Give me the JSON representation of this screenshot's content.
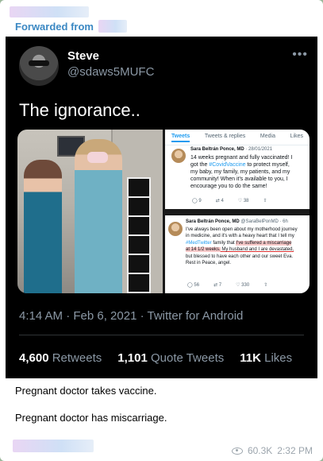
{
  "message": {
    "forwarded_label": "Forwarded from",
    "caption_lines": [
      "Pregnant doctor takes vaccine.",
      "Pregnant doctor has miscarriage."
    ],
    "views": "60.3K",
    "time": "2:32 PM"
  },
  "tweet": {
    "author_name": "Steve",
    "author_handle": "@sdaws5MUFC",
    "more": "•••",
    "text": "The ignorance..",
    "timestamp": "4:14 AM · Feb 6, 2021",
    "source": "Twitter for Android",
    "stats": [
      {
        "value": "4,600",
        "label": "Retweets"
      },
      {
        "value": "1,101",
        "label": "Quote Tweets"
      },
      {
        "value": "11K",
        "label": "Likes"
      }
    ]
  },
  "embedded_screenshot_top": {
    "tabs": [
      "Tweets",
      "Tweets & replies",
      "Media",
      "Likes"
    ],
    "author": "Sara Beltrán Ponce, MD",
    "date": "· 28/01/2021",
    "line1": "14 weeks pregnant and fully vaccinated! I",
    "line2_a": "got the ",
    "hashtag": "#CovidVaccine",
    "line2_b": " to protect myself,",
    "line3": "my baby, my family, my patients, and my",
    "line4": "community! When it's available to you, I",
    "line5": "encourage you to do the same!",
    "counts": [
      "9",
      "4",
      "38"
    ]
  },
  "embedded_screenshot_bottom": {
    "author": "Sara Beltrán Ponce, MD",
    "handle": "@SaraBelPonMD · 6h",
    "line1": "I've always been open about my motherhood journey",
    "line2": "in medicine, and it's with a heavy heart that I tell my",
    "line3_a": "#MedTwitter",
    "line3_b": " family that ",
    "line3_red": "I've suffered a miscarriage",
    "line4_red": "at 14 1/2 weeks.",
    "line4_b": " My husband and I are devastated,",
    "line5": "but blessed to have each other and our sweet Eva.",
    "line6": "Rest in Peace, angel.",
    "counts": [
      "56",
      "7",
      "330"
    ]
  },
  "colors": {
    "accent": "#3b88c3",
    "tweet_bg": "#000000",
    "muted": "#8b98a5",
    "chat_bg": "#9ab79a"
  }
}
